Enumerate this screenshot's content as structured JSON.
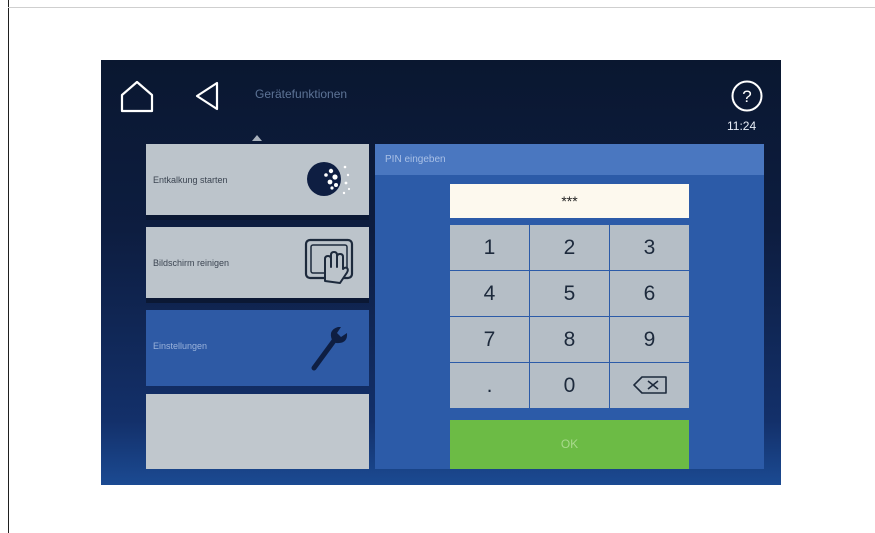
{
  "header": {
    "title": "Gerätefunktionen",
    "time": "11:24",
    "home_icon": "home-icon",
    "back_icon": "back-icon",
    "help_icon": "help-icon"
  },
  "menu": {
    "items": [
      {
        "label": "Entkalkung starten",
        "icon": "descaling-icon",
        "state": "normal"
      },
      {
        "label": "Bildschirm reinigen",
        "icon": "screen-cleaning-icon",
        "state": "normal"
      },
      {
        "label": "Einstellungen",
        "icon": "wrench-icon",
        "state": "selected"
      },
      {
        "label": "",
        "icon": "",
        "state": "empty"
      }
    ]
  },
  "pin": {
    "title": "PIN eingeben",
    "display": "***",
    "keys": [
      "1",
      "2",
      "3",
      "4",
      "5",
      "6",
      "7",
      "8",
      "9",
      ".",
      "0"
    ],
    "backspace_icon": "backspace-icon",
    "ok_label": "OK"
  },
  "colors": {
    "background_dark": "#0d1d40",
    "panel_blue": "#2c5ba8",
    "selected_blue": "#2e5aa5",
    "key_grey": "#b5bec6",
    "ok_green": "#6cbb45"
  }
}
